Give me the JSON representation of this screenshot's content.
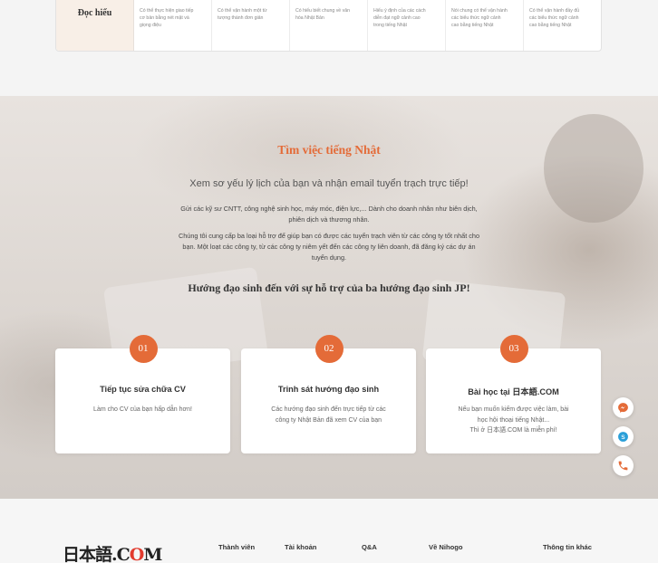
{
  "skills": {
    "row_label": "Đọc hiểu",
    "cells": [
      [
        "Có thể thực hiện giao tiếp",
        "cơ bản bằng nét mặt và",
        "giọng điệu"
      ],
      [
        "Có thể vận hành một từ",
        "tượng thành đơn giản"
      ],
      [
        "Có hiểu biết chung về văn",
        "hóa Nhật Bản"
      ],
      [
        "Hiểu ý định của các cách",
        "diễn đạt ngữ cảnh cao",
        "trong tiếng Nhật"
      ],
      [
        "Nói chung có thể vận hành",
        "các biểu thức ngữ cảnh",
        "cao bằng tiếng Nhật"
      ],
      [
        "Có thể vận hành đầy đủ",
        "các biểu thức ngữ cảnh",
        "cao bằng tiếng Nhật"
      ]
    ]
  },
  "hero": {
    "title": "Tìm việc tiếng Nhật",
    "subtitle": "Xem sơ yếu lý lịch của bạn và nhận email tuyển trạch trực tiếp!",
    "para1_line1": "Gửi các kỹ sư CNTT, công nghệ sinh học, máy móc, điện lực,... Dành cho doanh nhân như biên dịch,",
    "para1_line2": "phiên dịch và thương nhân.",
    "para2_line1": "Chúng tôi cung cấp ba loại hỗ trợ để giúp bạn có được các tuyển trạch viên từ các công ty tốt nhất cho",
    "para2_line2": "bạn. Một loạt các công ty, từ các công ty niêm yết đến các công ty liên doanh, đã đăng ký các dự án",
    "para2_line3": "tuyển dụng.",
    "guide_title": "Hướng đạo sinh đến với sự hỗ trợ của ba hướng đạo sinh JP!"
  },
  "cards": [
    {
      "num": "01",
      "title": "Tiếp tục sửa chữa CV",
      "lines": [
        "Làm cho CV của bạn hấp dẫn hơn!"
      ]
    },
    {
      "num": "02",
      "title": "Trinh sát hướng đạo sinh",
      "lines": [
        "Các hướng đạo sinh đến trực tiếp từ các",
        "công ty Nhật Bản đã xem CV của bạn"
      ]
    },
    {
      "num": "03",
      "title": "Bài học tại 日本語.COM",
      "lines": [
        "Nếu bạn muốn kiếm được việc làm, bài",
        "học hội thoại tiếng Nhật...",
        "Thì ở 日本語.COM là miễn phí!"
      ]
    }
  ],
  "float_buttons": [
    "messenger-icon",
    "skype-icon",
    "phone-icon"
  ],
  "footer": {
    "logo_prefix": "日本語.C",
    "logo_o": "O",
    "logo_suffix": "M",
    "nav": [
      "Thành viên",
      "Tài khoản",
      "Q&A",
      "Về Nihogo",
      "Thông tin khác"
    ]
  },
  "colors": {
    "accent": "#e46b38",
    "hero_bg": "#ddd7d2",
    "card_bg": "#ffffff"
  }
}
